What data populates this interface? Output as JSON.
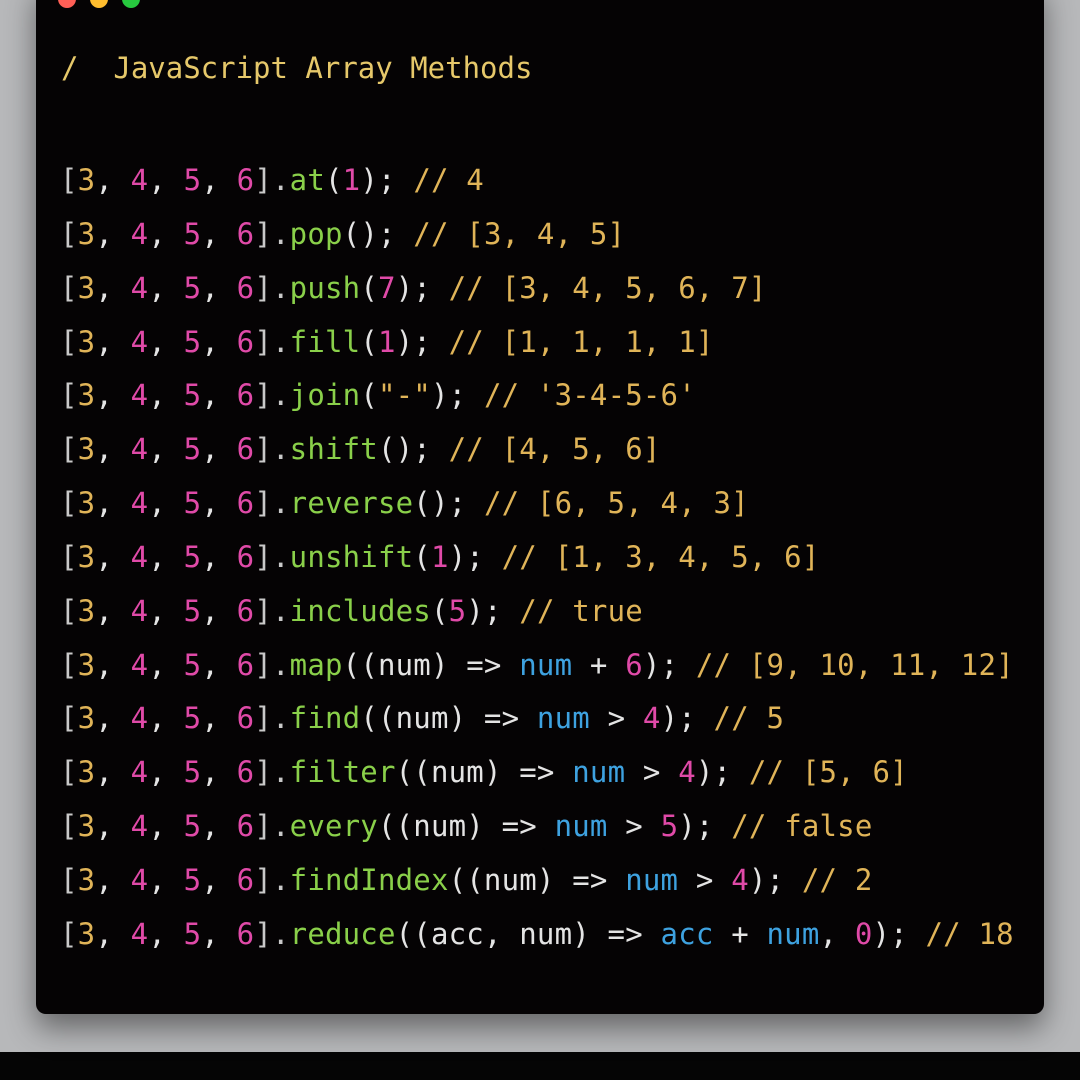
{
  "window": {
    "traffic_lights": [
      {
        "name": "close",
        "color": "#ff5f56"
      },
      {
        "name": "minimize",
        "color": "#ffbd2e"
      },
      {
        "name": "maximize",
        "color": "#27c93f"
      }
    ],
    "title": "/  JavaScript Array Methods",
    "title_color": "#e6c86a"
  },
  "colors": {
    "bracket": "#c9c9c9",
    "number_a": "#e0b458",
    "number_b": "#e04aa8",
    "method": "#8ad04a",
    "string": "#e0b458",
    "comment": "#e0b458",
    "variable": "#3ea2e0",
    "plain": "#e4e4e4"
  },
  "code_lines": [
    [
      [
        "[",
        "bracket"
      ],
      [
        "3",
        "number_a"
      ],
      [
        ", ",
        "plain"
      ],
      [
        "4",
        "number_b"
      ],
      [
        ", ",
        "plain"
      ],
      [
        "5",
        "number_b"
      ],
      [
        ", ",
        "plain"
      ],
      [
        "6",
        "number_b"
      ],
      [
        "].",
        "bracket"
      ],
      [
        "at",
        "method"
      ],
      [
        "(",
        "plain"
      ],
      [
        "1",
        "number_b"
      ],
      [
        ");",
        "plain"
      ],
      [
        " // 4",
        "comment"
      ]
    ],
    [
      [
        "[",
        "bracket"
      ],
      [
        "3",
        "number_a"
      ],
      [
        ", ",
        "plain"
      ],
      [
        "4",
        "number_b"
      ],
      [
        ", ",
        "plain"
      ],
      [
        "5",
        "number_b"
      ],
      [
        ", ",
        "plain"
      ],
      [
        "6",
        "number_b"
      ],
      [
        "].",
        "bracket"
      ],
      [
        "pop",
        "method"
      ],
      [
        "();",
        "plain"
      ],
      [
        " // [3, 4, 5]",
        "comment"
      ]
    ],
    [
      [
        "[",
        "bracket"
      ],
      [
        "3",
        "number_a"
      ],
      [
        ", ",
        "plain"
      ],
      [
        "4",
        "number_b"
      ],
      [
        ", ",
        "plain"
      ],
      [
        "5",
        "number_b"
      ],
      [
        ", ",
        "plain"
      ],
      [
        "6",
        "number_b"
      ],
      [
        "].",
        "bracket"
      ],
      [
        "push",
        "method"
      ],
      [
        "(",
        "plain"
      ],
      [
        "7",
        "number_b"
      ],
      [
        ");",
        "plain"
      ],
      [
        " // [3, 4, 5, 6, 7]",
        "comment"
      ]
    ],
    [
      [
        "[",
        "bracket"
      ],
      [
        "3",
        "number_a"
      ],
      [
        ", ",
        "plain"
      ],
      [
        "4",
        "number_b"
      ],
      [
        ", ",
        "plain"
      ],
      [
        "5",
        "number_b"
      ],
      [
        ", ",
        "plain"
      ],
      [
        "6",
        "number_b"
      ],
      [
        "].",
        "bracket"
      ],
      [
        "fill",
        "method"
      ],
      [
        "(",
        "plain"
      ],
      [
        "1",
        "number_b"
      ],
      [
        ");",
        "plain"
      ],
      [
        " // [1, 1, 1, 1]",
        "comment"
      ]
    ],
    [
      [
        "[",
        "bracket"
      ],
      [
        "3",
        "number_a"
      ],
      [
        ", ",
        "plain"
      ],
      [
        "4",
        "number_b"
      ],
      [
        ", ",
        "plain"
      ],
      [
        "5",
        "number_b"
      ],
      [
        ", ",
        "plain"
      ],
      [
        "6",
        "number_b"
      ],
      [
        "].",
        "bracket"
      ],
      [
        "join",
        "method"
      ],
      [
        "(",
        "plain"
      ],
      [
        "\"-\"",
        "string"
      ],
      [
        ");",
        "plain"
      ],
      [
        " // '3-4-5-6'",
        "comment"
      ]
    ],
    [
      [
        "[",
        "bracket"
      ],
      [
        "3",
        "number_a"
      ],
      [
        ", ",
        "plain"
      ],
      [
        "4",
        "number_b"
      ],
      [
        ", ",
        "plain"
      ],
      [
        "5",
        "number_b"
      ],
      [
        ", ",
        "plain"
      ],
      [
        "6",
        "number_b"
      ],
      [
        "].",
        "bracket"
      ],
      [
        "shift",
        "method"
      ],
      [
        "();",
        "plain"
      ],
      [
        " // [4, 5, 6]",
        "comment"
      ]
    ],
    [
      [
        "[",
        "bracket"
      ],
      [
        "3",
        "number_a"
      ],
      [
        ", ",
        "plain"
      ],
      [
        "4",
        "number_b"
      ],
      [
        ", ",
        "plain"
      ],
      [
        "5",
        "number_b"
      ],
      [
        ", ",
        "plain"
      ],
      [
        "6",
        "number_b"
      ],
      [
        "].",
        "bracket"
      ],
      [
        "reverse",
        "method"
      ],
      [
        "();",
        "plain"
      ],
      [
        " // [6, 5, 4, 3]",
        "comment"
      ]
    ],
    [
      [
        "[",
        "bracket"
      ],
      [
        "3",
        "number_a"
      ],
      [
        ", ",
        "plain"
      ],
      [
        "4",
        "number_b"
      ],
      [
        ", ",
        "plain"
      ],
      [
        "5",
        "number_b"
      ],
      [
        ", ",
        "plain"
      ],
      [
        "6",
        "number_b"
      ],
      [
        "].",
        "bracket"
      ],
      [
        "unshift",
        "method"
      ],
      [
        "(",
        "plain"
      ],
      [
        "1",
        "number_b"
      ],
      [
        ");",
        "plain"
      ],
      [
        " // [1, 3, 4, 5, 6]",
        "comment"
      ]
    ],
    [
      [
        "[",
        "bracket"
      ],
      [
        "3",
        "number_a"
      ],
      [
        ", ",
        "plain"
      ],
      [
        "4",
        "number_b"
      ],
      [
        ", ",
        "plain"
      ],
      [
        "5",
        "number_b"
      ],
      [
        ", ",
        "plain"
      ],
      [
        "6",
        "number_b"
      ],
      [
        "].",
        "bracket"
      ],
      [
        "includes",
        "method"
      ],
      [
        "(",
        "plain"
      ],
      [
        "5",
        "number_b"
      ],
      [
        ");",
        "plain"
      ],
      [
        " // true",
        "comment"
      ]
    ],
    [
      [
        "[",
        "bracket"
      ],
      [
        "3",
        "number_a"
      ],
      [
        ", ",
        "plain"
      ],
      [
        "4",
        "number_b"
      ],
      [
        ", ",
        "plain"
      ],
      [
        "5",
        "number_b"
      ],
      [
        ", ",
        "plain"
      ],
      [
        "6",
        "number_b"
      ],
      [
        "].",
        "bracket"
      ],
      [
        "map",
        "method"
      ],
      [
        "((num) => ",
        "plain"
      ],
      [
        "num",
        "variable"
      ],
      [
        " + ",
        "plain"
      ],
      [
        "6",
        "number_b"
      ],
      [
        ");",
        "plain"
      ],
      [
        " // [9, 10, 11, 12]",
        "comment"
      ]
    ],
    [
      [
        "[",
        "bracket"
      ],
      [
        "3",
        "number_a"
      ],
      [
        ", ",
        "plain"
      ],
      [
        "4",
        "number_b"
      ],
      [
        ", ",
        "plain"
      ],
      [
        "5",
        "number_b"
      ],
      [
        ", ",
        "plain"
      ],
      [
        "6",
        "number_b"
      ],
      [
        "].",
        "bracket"
      ],
      [
        "find",
        "method"
      ],
      [
        "((num) => ",
        "plain"
      ],
      [
        "num",
        "variable"
      ],
      [
        " > ",
        "plain"
      ],
      [
        "4",
        "number_b"
      ],
      [
        ");",
        "plain"
      ],
      [
        " // 5",
        "comment"
      ]
    ],
    [
      [
        "[",
        "bracket"
      ],
      [
        "3",
        "number_a"
      ],
      [
        ", ",
        "plain"
      ],
      [
        "4",
        "number_b"
      ],
      [
        ", ",
        "plain"
      ],
      [
        "5",
        "number_b"
      ],
      [
        ", ",
        "plain"
      ],
      [
        "6",
        "number_b"
      ],
      [
        "].",
        "bracket"
      ],
      [
        "filter",
        "method"
      ],
      [
        "((num) => ",
        "plain"
      ],
      [
        "num",
        "variable"
      ],
      [
        " > ",
        "plain"
      ],
      [
        "4",
        "number_b"
      ],
      [
        ");",
        "plain"
      ],
      [
        " // [5, 6]",
        "comment"
      ]
    ],
    [
      [
        "[",
        "bracket"
      ],
      [
        "3",
        "number_a"
      ],
      [
        ", ",
        "plain"
      ],
      [
        "4",
        "number_b"
      ],
      [
        ", ",
        "plain"
      ],
      [
        "5",
        "number_b"
      ],
      [
        ", ",
        "plain"
      ],
      [
        "6",
        "number_b"
      ],
      [
        "].",
        "bracket"
      ],
      [
        "every",
        "method"
      ],
      [
        "((num) => ",
        "plain"
      ],
      [
        "num",
        "variable"
      ],
      [
        " > ",
        "plain"
      ],
      [
        "5",
        "number_b"
      ],
      [
        ");",
        "plain"
      ],
      [
        " // false",
        "comment"
      ]
    ],
    [
      [
        "[",
        "bracket"
      ],
      [
        "3",
        "number_a"
      ],
      [
        ", ",
        "plain"
      ],
      [
        "4",
        "number_b"
      ],
      [
        ", ",
        "plain"
      ],
      [
        "5",
        "number_b"
      ],
      [
        ", ",
        "plain"
      ],
      [
        "6",
        "number_b"
      ],
      [
        "].",
        "bracket"
      ],
      [
        "findIndex",
        "method"
      ],
      [
        "((num) => ",
        "plain"
      ],
      [
        "num",
        "variable"
      ],
      [
        " > ",
        "plain"
      ],
      [
        "4",
        "number_b"
      ],
      [
        ");",
        "plain"
      ],
      [
        " // 2",
        "comment"
      ]
    ],
    [
      [
        "[",
        "bracket"
      ],
      [
        "3",
        "number_a"
      ],
      [
        ", ",
        "plain"
      ],
      [
        "4",
        "number_b"
      ],
      [
        ", ",
        "plain"
      ],
      [
        "5",
        "number_b"
      ],
      [
        ", ",
        "plain"
      ],
      [
        "6",
        "number_b"
      ],
      [
        "].",
        "bracket"
      ],
      [
        "reduce",
        "method"
      ],
      [
        "((acc, num) => ",
        "plain"
      ],
      [
        "acc",
        "variable"
      ],
      [
        " + ",
        "plain"
      ],
      [
        "num",
        "variable"
      ],
      [
        ", ",
        "plain"
      ],
      [
        "0",
        "number_b"
      ],
      [
        ");",
        "plain"
      ],
      [
        " // 18",
        "comment"
      ]
    ]
  ]
}
